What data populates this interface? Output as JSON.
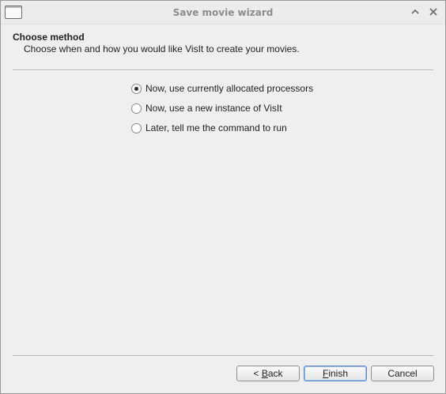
{
  "window": {
    "title": "Save movie wizard"
  },
  "page": {
    "title": "Choose method",
    "subtitle": "Choose when and how you would like VisIt to create your movies."
  },
  "options": [
    {
      "label": "Now, use currently allocated processors",
      "checked": true
    },
    {
      "label": "Now, use a new instance of VisIt",
      "checked": false
    },
    {
      "label": "Later, tell me the command to run",
      "checked": false
    }
  ],
  "buttons": {
    "back_prefix": "< ",
    "back_mnemonic": "B",
    "back_rest": "ack",
    "finish_mnemonic": "F",
    "finish_rest": "inish",
    "cancel": "Cancel"
  }
}
